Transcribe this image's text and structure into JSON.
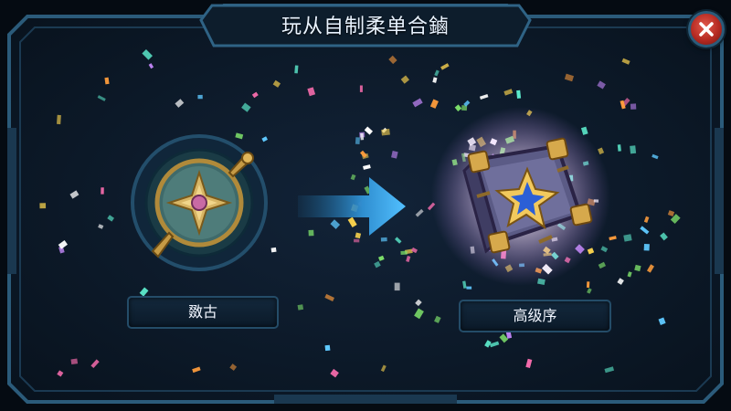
{
  "dialog": {
    "title": "玩从自制柔单合鏀",
    "close_icon": "close-icon"
  },
  "source_item": {
    "name": "敪古",
    "icon": "compass-medallion-icon"
  },
  "arrow_icon": "right-arrow-icon",
  "result_item": {
    "name": "高级序",
    "icon": "ornate-chest-icon"
  },
  "colors": {
    "frame": "#2b5b7a",
    "background": "#0c1826",
    "arrow": "#3aa8e8",
    "close": "#c23a2e"
  }
}
